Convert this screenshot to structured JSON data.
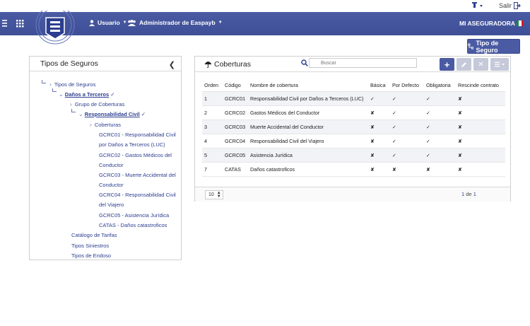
{
  "topbar": {
    "salir_label": "Salir"
  },
  "nav": {
    "usuario_label": "Usuario",
    "admin_label": "Administrador de Easpayb",
    "aseguradora_label": "MI ASEGURADORA"
  },
  "tipo_button_label": "Tipo de Seguro",
  "left_panel": {
    "title": "Tipos de Seguros",
    "tree": {
      "root": "Tipos de Seguros",
      "danos": "Daños a Terceros",
      "grupo": "Grupo de Coberturas",
      "resp_civil": "Responsabilidad Civil",
      "coberturas": "Coberturas",
      "items": [
        "GCRC01 - Responsabilidad Civil",
        "por Daños a Terceros (LUC)",
        "GCRC02 - Gastos Médicos del",
        "Conductor",
        "GCRC03 - Muerte Accidental del",
        "Conductor",
        "GCRC04 - Responsabilidad Civil",
        "del Viajero",
        "GCRC05 - Asistencia Jurídica",
        "CATAS - Daños catastroficos"
      ],
      "catalogo": "Catálogo de Tarifas",
      "siniestros": "Tipos Siniestros",
      "endoso": "Tipos de Endoso"
    }
  },
  "right_panel": {
    "title": "Coberturas",
    "search_placeholder": "Buscar",
    "columns": [
      "Orden",
      "Código",
      "Nombre de cobertura",
      "Básica",
      "Por Defecto",
      "Obligatoria",
      "Rescinde contrato"
    ],
    "rows": [
      [
        "1",
        "GCRC01",
        "Responsabilidad Civil por Daños a Terceros (LUC)",
        "✓",
        "✓",
        "✓",
        "✘"
      ],
      [
        "2",
        "GCRC02",
        "Gastos Médicos del Conductor",
        "✘",
        "✓",
        "✓",
        "✘"
      ],
      [
        "3",
        "GCRC03",
        "Muerte Accidental del Conductor",
        "✘",
        "✓",
        "✓",
        "✘"
      ],
      [
        "4",
        "GCRC04",
        "Responsabilidad Civil del Viajero",
        "✘",
        "✓",
        "✓",
        "✘"
      ],
      [
        "5",
        "GCRC05",
        "Asistencia Jurídica",
        "✘",
        "✓",
        "✓",
        "✘"
      ],
      [
        "7",
        "CATAS",
        "Daños catastroficos",
        "✘",
        "✘",
        "✘",
        "✘"
      ]
    ],
    "page_size": "10",
    "page_current": "1",
    "page_de": "de",
    "page_total": "1"
  },
  "colors": {
    "brand": "#4a5ba3",
    "accent": "#2c3e8f"
  }
}
